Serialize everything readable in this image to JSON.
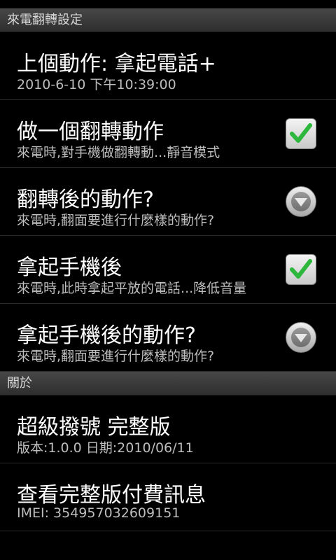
{
  "sections": [
    {
      "header": "來電翻轉設定",
      "items": [
        {
          "title": "上個動作: 拿起電話+",
          "summary": "2010-6-10 下午10:39:00",
          "widget": "none"
        },
        {
          "title": "做一個翻轉動作",
          "summary": "來電時,對手機做翻轉動...靜音模式",
          "widget": "checkbox",
          "checked": true
        },
        {
          "title": "翻轉後的動作?",
          "summary": "來電時,翻面要進行什麼樣的動作?",
          "widget": "dropdown"
        },
        {
          "title": "拿起手機後",
          "summary": "來電時,此時拿起平放的電話...降低音量",
          "widget": "checkbox",
          "checked": true
        },
        {
          "title": "拿起手機後的動作?",
          "summary": "來電時,翻面要進行什麼樣的動作?",
          "widget": "dropdown"
        }
      ]
    },
    {
      "header": "關於",
      "items": [
        {
          "title": "超級撥號 完整版",
          "summary": "版本:1.0.0 日期:2010/06/11",
          "widget": "none"
        },
        {
          "title": "查看完整版付費訊息",
          "summary": "IMEI: 354957032609151",
          "widget": "none"
        }
      ]
    }
  ],
  "colors": {
    "check": "#2db83d",
    "background": "#000000"
  }
}
